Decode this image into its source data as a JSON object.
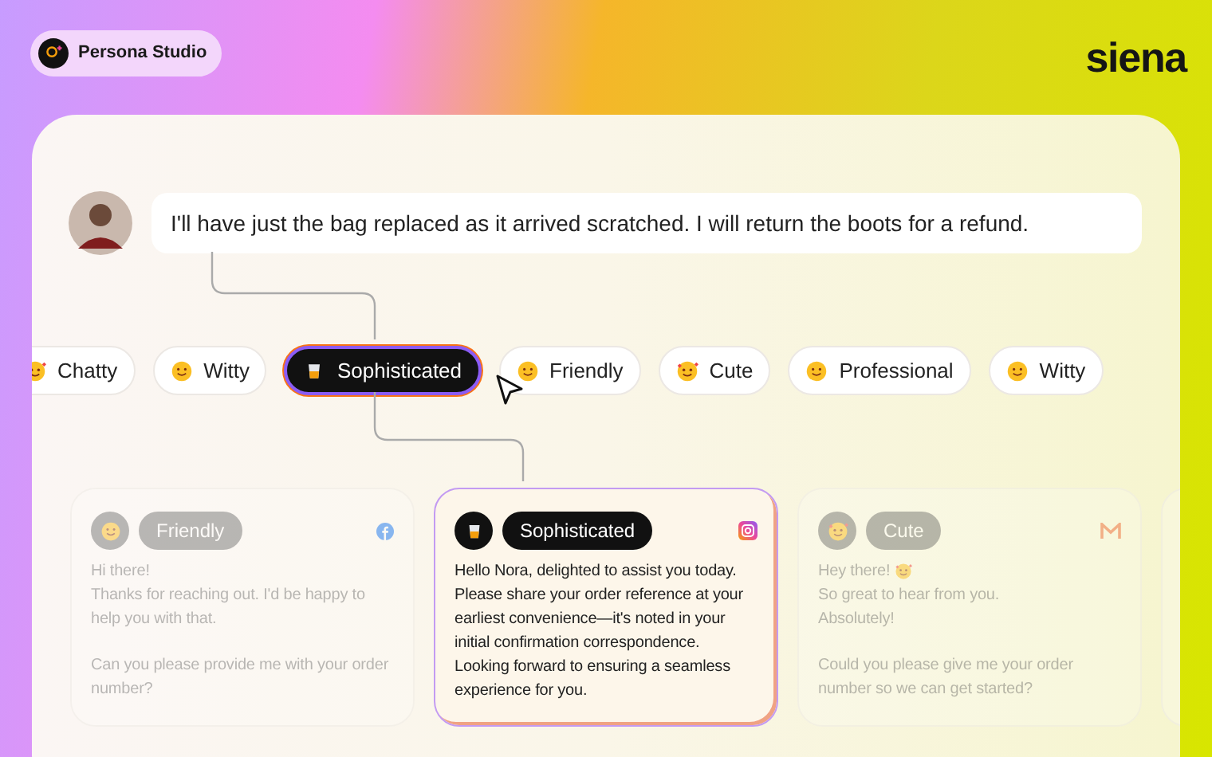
{
  "badge": {
    "label": "Persona Studio"
  },
  "logo": {
    "text": "siena"
  },
  "message": {
    "text": "I'll have just the bag replaced as it arrived scratched. I will return the boots for a refund."
  },
  "tones": [
    {
      "label": "Chatty",
      "kind": "hearts",
      "selected": false
    },
    {
      "label": "Witty",
      "kind": "smile",
      "selected": false
    },
    {
      "label": "Sophisticated",
      "kind": "glass",
      "selected": true
    },
    {
      "label": "Friendly",
      "kind": "smile",
      "selected": false
    },
    {
      "label": "Cute",
      "kind": "hearts",
      "selected": false
    },
    {
      "label": "Professional",
      "kind": "smile",
      "selected": false
    },
    {
      "label": "Witty",
      "kind": "smile",
      "selected": false
    }
  ],
  "replies": [
    {
      "tone": "Friendly",
      "kind": "smile",
      "channel": {
        "kind": "facebook"
      },
      "selected": false,
      "greeting": "Hi there!",
      "paragraphs": [
        "Thanks for reaching out. I'd be happy to help you with that.",
        "Can you please provide me with your order number?"
      ]
    },
    {
      "tone": "Sophisticated",
      "kind": "glass",
      "channel": {
        "kind": "instagram"
      },
      "selected": true,
      "paragraphs": [
        "Hello Nora, delighted to assist you today. Please share your order reference at your earliest convenience—it's noted in your initial confirmation correspondence. Looking forward to ensuring a seamless experience for you."
      ]
    },
    {
      "tone": "Cute",
      "kind": "hearts",
      "channel": {
        "kind": "gmail"
      },
      "selected": false,
      "greeting": "Hey there!",
      "greeting_emoji": {
        "kind": "hearts"
      },
      "paragraphs": [
        "So great to hear from you.\nAbsolutely!",
        "Could you please give me your order number so we can get started?"
      ]
    }
  ]
}
